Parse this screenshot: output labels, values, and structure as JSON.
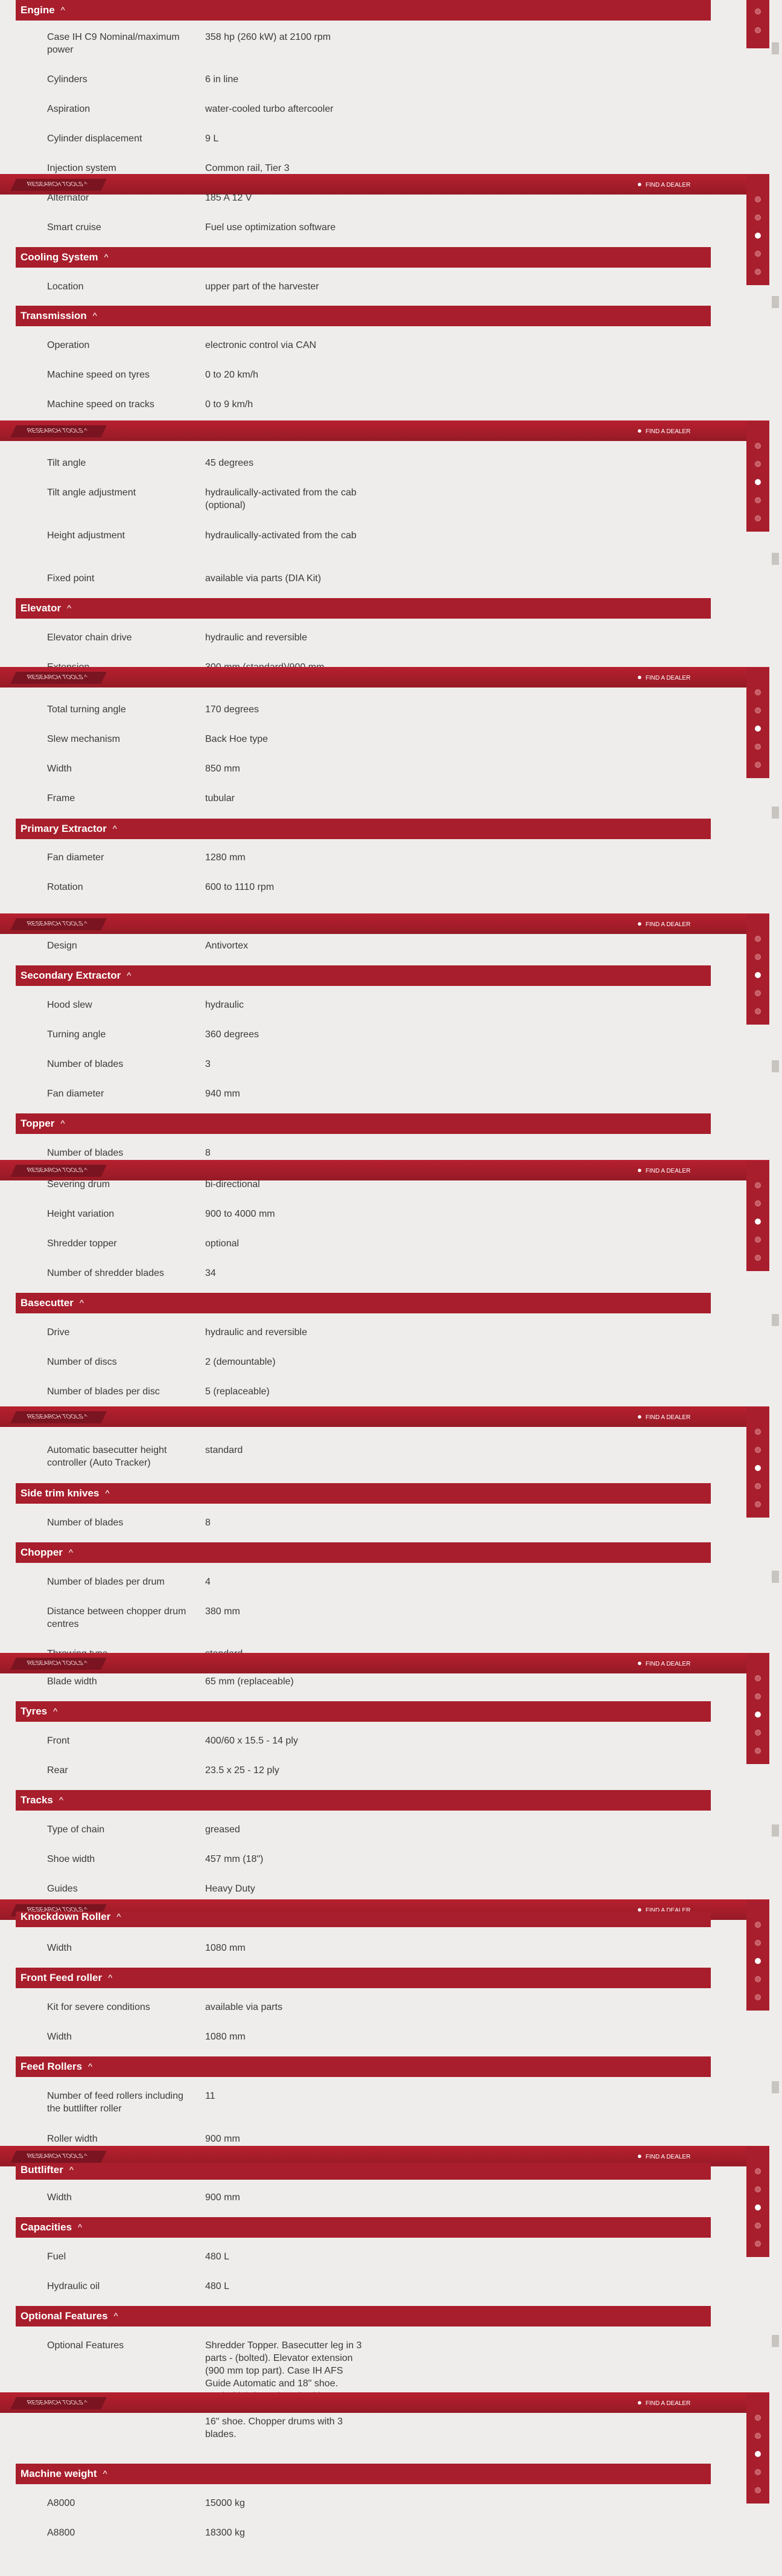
{
  "colors": {
    "accent": "#a81e2c",
    "background": "#efedeb",
    "text": "#3a3a3a"
  },
  "sticky_bar": {
    "research_label": "RESEARCH TOOLS",
    "chevron": "^",
    "dealer_label": "FIND A DEALER",
    "dealer_icon": "map-pin-icon"
  },
  "sections": [
    {
      "title": "Engine",
      "rows": [
        [
          "Case IH C9 Nominal/maximum power",
          "358 hp (260 kW) at 2100 rpm"
        ],
        [
          "Cylinders",
          "6 in line"
        ],
        [
          "Aspiration",
          "water-cooled turbo aftercooler"
        ],
        [
          "Cylinder displacement",
          "9 L"
        ],
        [
          "Injection system",
          "Common rail, Tier 3"
        ],
        [
          "Alternator",
          "185 A 12 V"
        ],
        [
          "Smart cruise",
          "Fuel use optimization software"
        ]
      ]
    },
    {
      "title": "Cooling System",
      "rows": [
        [
          "Location",
          "upper part of the harvester"
        ]
      ]
    },
    {
      "title": "Transmission",
      "rows": [
        [
          "Operation",
          "electronic control via CAN"
        ],
        [
          "Machine speed on tyres",
          "0 to 20 km/h"
        ],
        [
          "Machine speed on tracks",
          "0 to 9 km/h"
        ]
      ]
    },
    {
      "title": "",
      "rows": [
        [
          "Tilt angle",
          "45 degrees"
        ],
        [
          "Tilt angle adjustment",
          "hydraulically-activated from the cab (optional)"
        ],
        [
          "Height adjustment",
          "hydraulically-activated from the cab"
        ],
        [
          "Fixed point",
          "available via parts (DIA Kit)"
        ]
      ]
    },
    {
      "title": "Elevator",
      "rows": [
        [
          "Elevator chain drive",
          "hydraulic and reversible"
        ],
        [
          "Extension",
          "300 mm (standard)/900 mm"
        ],
        [
          "Total turning angle",
          "170 degrees"
        ],
        [
          "Slew mechanism",
          "Back Hoe type"
        ],
        [
          "Width",
          "850 mm"
        ],
        [
          "Frame",
          "tubular"
        ]
      ]
    },
    {
      "title": "Primary Extractor",
      "rows": [
        [
          "Fan diameter",
          "1280 mm"
        ],
        [
          "Rotation",
          "600 to 1110 rpm"
        ],
        [
          "Design",
          "Antivortex"
        ]
      ]
    },
    {
      "title": "Secondary Extractor",
      "rows": [
        [
          "Hood slew",
          "hydraulic"
        ],
        [
          "Turning angle",
          "360 degrees"
        ],
        [
          "Number of blades",
          "3"
        ],
        [
          "Fan diameter",
          "940 mm"
        ]
      ]
    },
    {
      "title": "Topper",
      "rows": [
        [
          "Number of blades",
          "8"
        ],
        [
          "Severing drum",
          "bi-directional"
        ],
        [
          "Height variation",
          "900 to 4000 mm"
        ],
        [
          "Shredder topper",
          "optional"
        ],
        [
          "Number of shredder blades",
          "34"
        ]
      ]
    },
    {
      "title": "Basecutter",
      "rows": [
        [
          "Drive",
          "hydraulic and reversible"
        ],
        [
          "Number of discs",
          "2 (demountable)"
        ],
        [
          "Number of blades per disc",
          "5 (replaceable)"
        ],
        [
          "Automatic basecutter height controller (Auto Tracker)",
          "standard"
        ]
      ]
    },
    {
      "title": "Side trim knives",
      "rows": [
        [
          "Number of blades",
          "8"
        ]
      ]
    },
    {
      "title": "Chopper",
      "rows": [
        [
          "Number of blades per drum",
          "4"
        ],
        [
          "Distance between chopper drum centres",
          "380 mm"
        ],
        [
          "Throwing type",
          "standard"
        ],
        [
          "Blade width",
          "65 mm (replaceable)"
        ]
      ]
    },
    {
      "title": "Tyres",
      "rows": [
        [
          "Front",
          "400/60 x 15.5 - 14 ply"
        ],
        [
          "Rear",
          "23.5 x 25 - 12 ply"
        ]
      ]
    },
    {
      "title": "Tracks",
      "rows": [
        [
          "Type of chain",
          "greased"
        ],
        [
          "Shoe width",
          "457 mm (18\")"
        ],
        [
          "Guides",
          "Heavy Duty"
        ]
      ]
    },
    {
      "title": "Knockdown Roller",
      "rows": [
        [
          "Width",
          "1080 mm"
        ]
      ]
    },
    {
      "title": "Front Feed roller",
      "rows": [
        [
          "Kit for severe conditions",
          "available via parts"
        ],
        [
          "Width",
          "1080 mm"
        ]
      ]
    },
    {
      "title": "Feed Rollers",
      "rows": [
        [
          "Number of feed rollers including the buttlifter roller",
          "11"
        ],
        [
          "Roller width",
          "900 mm"
        ]
      ]
    },
    {
      "title": "Buttlifter",
      "rows": [
        [
          "Width",
          "900 mm"
        ]
      ]
    },
    {
      "title": "Capacities",
      "rows": [
        [
          "Fuel",
          "480 L"
        ],
        [
          "Hydraulic oil",
          "480 L"
        ]
      ]
    },
    {
      "title": "Optional Features",
      "rows": [
        [
          "Optional Features",
          "Shredder Topper. Basecutter leg in 3 parts - (bolted). Elevator extension (900 mm top part). Case IH AFS Guide Automatic and 18\" shoe. Sealed lubricated track with 18\" shoe. Sealed lubricated track with 16\" shoe. Chopper drums with 3 blades."
        ]
      ]
    },
    {
      "title": "Machine weight",
      "rows": [
        [
          "A8000",
          "15000 kg"
        ],
        [
          "A8800",
          "18300 kg"
        ]
      ]
    }
  ],
  "chevron": "^"
}
